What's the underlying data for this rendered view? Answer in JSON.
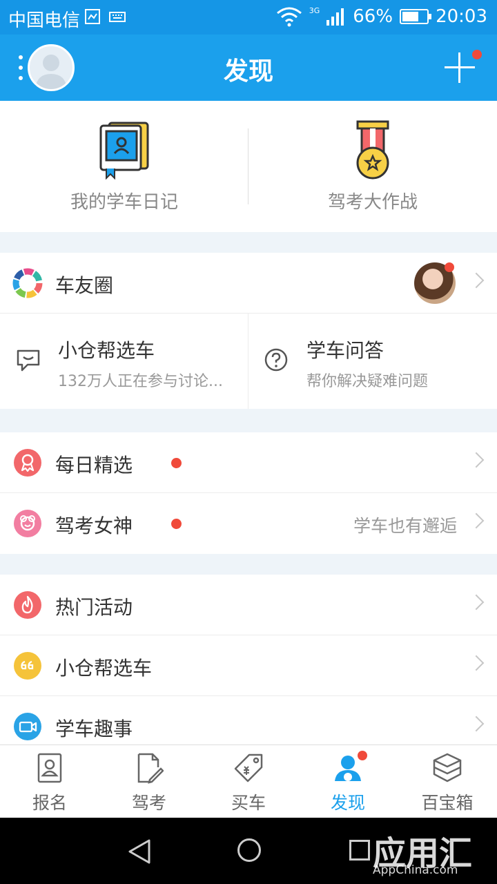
{
  "status_bar": {
    "carrier": "中国电信",
    "network": "3G",
    "battery": "66%",
    "battery_level": 0.66,
    "time": "20:03"
  },
  "header": {
    "title": "发现"
  },
  "top_cards": [
    {
      "label": "我的学车日记",
      "icon": "diary-book-icon"
    },
    {
      "label": "驾考大作战",
      "icon": "medal-icon"
    }
  ],
  "section1": {
    "circle": {
      "label": "车友圈",
      "icon": "color-wheel-icon"
    },
    "pairs": [
      {
        "title": "小仓帮选车",
        "subtitle": "132万人正在参与讨论...",
        "icon": "chat-bubble-icon"
      },
      {
        "title": "学车问答",
        "subtitle": "帮你解决疑难问题",
        "icon": "question-bubble-icon"
      }
    ]
  },
  "section2": {
    "items": [
      {
        "label": "每日精选",
        "note": "",
        "icon": "ribbon-icon",
        "color": "#f2676a"
      },
      {
        "label": "驾考女神",
        "note": "学车也有邂逅",
        "icon": "goddess-icon",
        "color": "#f27ea1"
      }
    ]
  },
  "section3": {
    "items": [
      {
        "label": "热门活动",
        "icon": "flame-icon",
        "color": "#f2676a"
      },
      {
        "label": "小仓帮选车",
        "icon": "quote-icon",
        "color": "#f5c33a"
      },
      {
        "label": "学车趣事",
        "icon": "video-camera-icon",
        "color": "#2aa3e6"
      }
    ]
  },
  "bottom_nav": [
    {
      "label": "报名",
      "icon": "id-card-icon"
    },
    {
      "label": "驾考",
      "icon": "edit-doc-icon"
    },
    {
      "label": "买车",
      "icon": "price-tag-icon"
    },
    {
      "label": "发现",
      "icon": "discover-person-icon",
      "active": true
    },
    {
      "label": "百宝箱",
      "icon": "toolbox-icon"
    }
  ],
  "watermark": {
    "title": "应用汇",
    "subtitle": "AppChina.com"
  },
  "colors": {
    "primary": "#1ba0ec",
    "status_bar": "#1596e6",
    "badge_red": "#f04a3a"
  }
}
